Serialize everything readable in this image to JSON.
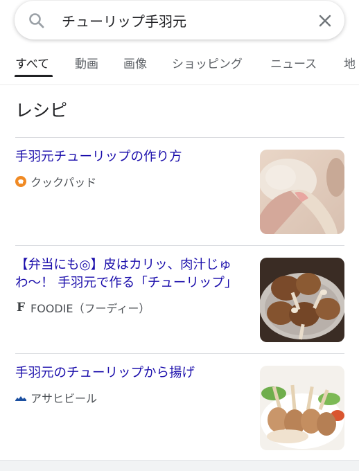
{
  "search": {
    "query": "チューリップ手羽元"
  },
  "tabs": [
    {
      "label": "すべて"
    },
    {
      "label": "動画"
    },
    {
      "label": "画像"
    },
    {
      "label": "ショッピング"
    },
    {
      "label": "ニュース"
    },
    {
      "label": "地"
    }
  ],
  "section": {
    "title": "レシピ"
  },
  "recipes": [
    {
      "title": "手羽元チューリップの作り方",
      "source": "クックパッド",
      "source_icon": "cookpad-logo-icon"
    },
    {
      "title": "【弁当にも◎】皮はカリッ、肉汁じゅわ〜！ 手羽元で作る「チューリップ」",
      "source": "FOODIE（フーディー）",
      "source_icon": "foodie-logo-icon"
    },
    {
      "title": "手羽元のチューリップから揚げ",
      "source": "アサヒビール",
      "source_icon": "asahi-logo-icon"
    }
  ],
  "colors": {
    "link": "#1a0dab",
    "source_text": "#4d5156",
    "tab_inactive": "#5f6368",
    "cookpad": "#f08a24",
    "asahi": "#1b4fa0"
  }
}
